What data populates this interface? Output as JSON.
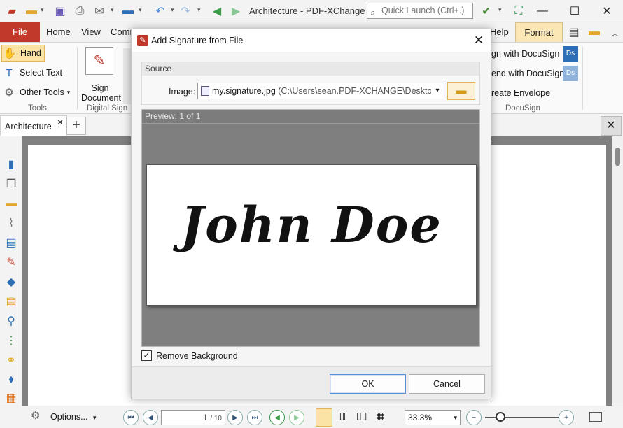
{
  "window": {
    "title": "Architecture - PDF-XChange E...",
    "quick_launch_placeholder": "Quick Launch (Ctrl+.)"
  },
  "ribbon": {
    "tabs": [
      "File",
      "Home",
      "View",
      "Comm",
      "Help",
      "Format"
    ],
    "tools": {
      "hand": "Hand",
      "select_text": "Select Text",
      "other_tools": "Other Tools",
      "group_label": "Tools"
    },
    "digital_sign": {
      "sign_line1": "Sign",
      "sign_line2": "Document",
      "group_label": "Digital Sign"
    },
    "docusign": {
      "sign_with": "gn with DocuSign",
      "send_with": "end with DocuSign",
      "create_envelope": "reate Envelope",
      "group_label": "DocuSign"
    }
  },
  "document_tab": {
    "label": "Architecture"
  },
  "dialog": {
    "title": "Add Signature from File",
    "source_heading": "Source",
    "image_label": "Image:",
    "image_file": "my.signature.jpg",
    "image_path": " (C:\\Users\\sean.PDF-XCHANGE\\Desktop\\m",
    "preview_heading": "Preview: 1 of 1",
    "signature_text": "John Doe",
    "remove_background_label": "Remove Background",
    "remove_background_checked": true,
    "ok_label": "OK",
    "cancel_label": "Cancel"
  },
  "statusbar": {
    "options_label": "Options...",
    "page_current": "1",
    "page_total": "/ 10",
    "zoom": "33.3%"
  },
  "icons": [
    "undo-icon",
    "redo-icon",
    "save-icon",
    "print-icon",
    "email-icon",
    "scan-icon",
    "back-icon",
    "forward-icon",
    "search-icon",
    "folder-icon",
    "hand-icon",
    "select-text-icon",
    "gear-icon",
    "bookmark-icon",
    "comment-icon",
    "attachment-icon",
    "layers-icon",
    "first-page-icon",
    "prev-page-icon",
    "next-page-icon",
    "last-page-icon",
    "zoom-in-icon",
    "zoom-out-icon"
  ],
  "colors": {
    "accent_file_tab": "#c0392b",
    "format_tab": "#fbe7b6",
    "hand_highlight": "#fbe3a6",
    "preview_bg": "#7f7f7f"
  }
}
